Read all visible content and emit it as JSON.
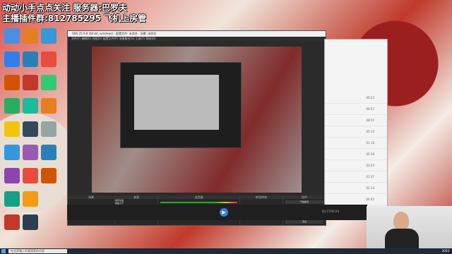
{
  "overlay": {
    "line1": "动动小手点点关注 服务器:巴罗夫",
    "line2": "主播插件群:812785295 飞机上房管"
  },
  "obs": {
    "title": "OBS 25.0.8 (64 bit, windows) - 配置文件: 未命名 - 场景: 未命名",
    "menu": "文件(F)  编辑(E)  视图(V)  配置文件(P)  场景集合(S)  工具(T)  帮助(H)",
    "docks": {
      "scenes": "场景",
      "sources": "来源",
      "mixer": "混音器",
      "transitions": "转场特效",
      "controls": "控件"
    },
    "sources": [
      "旋转动画",
      "插图文字",
      "字幕",
      "文本 (GDI+) 2",
      "旋转动画",
      "文本 (GDI+)"
    ],
    "controls": [
      "开始推流",
      "开始录制",
      "工作室模式",
      "设置",
      "退出"
    ],
    "statusbar": "LIVE: 00:00:00   REC: 00:00:00   CPU: 2.1%, 60.00 fps"
  },
  "player": {
    "time": "00:17/00:20"
  },
  "rightwin": {
    "rows": [
      "00:23",
      "09:57",
      "08:55",
      "05:14",
      "01:18",
      "05:58",
      "03:20",
      "01:37",
      "02:14",
      "04:05",
      "03:05"
    ]
  },
  "taskbar": {
    "search_placeholder": "在这里输入你要搜索的内容",
    "clock": "2020"
  }
}
